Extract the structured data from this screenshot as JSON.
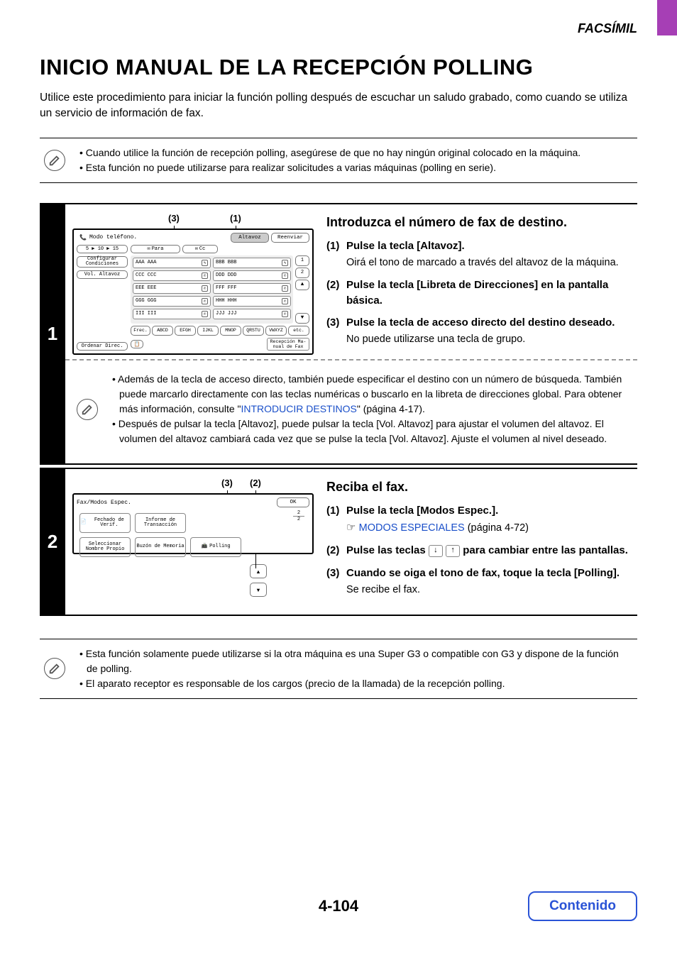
{
  "header": {
    "section_label": "FACSÍMIL"
  },
  "title": "INICIO MANUAL DE LA RECEPCIÓN POLLING",
  "intro": "Utilice este procedimiento para iniciar la función polling después de escuchar un saludo grabado, como cuando se utiliza un servicio de información de fax.",
  "note1": {
    "items": [
      "• Cuando utilice la función de recepción polling, asegúrese de que no hay ningún original colocado en la máquina.",
      "• Esta función no puede utilizarse para realizar solicitudes a varias máquinas (polling en serie)."
    ]
  },
  "step1": {
    "number": "1",
    "callouts": {
      "c1": "(1)",
      "c3": "(3)"
    },
    "heading": "Introduzca el número de fax de destino.",
    "items": [
      {
        "n": "(1)",
        "main": "Pulse la tecla [Altavoz].",
        "sub": "Oirá el tono de marcado a través del altavoz de la máquina."
      },
      {
        "n": "(2)",
        "main": "Pulse la tecla [Libreta de Direcciones] en la pantalla básica.",
        "sub": ""
      },
      {
        "n": "(3)",
        "main": "Pulse la tecla de acceso directo del destino deseado.",
        "sub": "No puede utilizarse una tecla de grupo."
      }
    ],
    "screen": {
      "title": "Modo teléfono.",
      "top_right": {
        "altavoz": "Altavoz",
        "reenviar": "Reenviar"
      },
      "para": "Para",
      "cc": "Cc",
      "scale": "5 ▶ 10 ▶ 15",
      "side": {
        "config": "Configurar Condiciones",
        "vol": "Vol. Altavoz",
        "ordenar": "Ordenar Direc."
      },
      "addresses": [
        [
          "AAA AAA",
          "BBB BBB"
        ],
        [
          "CCC CCC",
          "DDD DDD"
        ],
        [
          "EEE EEE",
          "FFF FFF"
        ],
        [
          "GGG GGG",
          "HHH HHH"
        ],
        [
          "III III",
          "JJJ JJJ"
        ]
      ],
      "page_indicator": [
        "1",
        "2"
      ],
      "frec": "Frec.",
      "tabs": [
        "ABCD",
        "EFGH",
        "IJKL",
        "MNOP",
        "QRSTU",
        "VWXYZ",
        "etc."
      ],
      "bottom_right": "Recepción Ma- nual de Fax"
    }
  },
  "midnote": {
    "items": [
      "• Además de la tecla de acceso directo, también puede especificar el destino con un número de búsqueda. También puede marcarlo directamente con las teclas numéricas o buscarlo en la libreta de direcciones global. Para obtener más información, consulte \"",
      "\" (página 4-17).",
      "• Después de pulsar la tecla [Altavoz], puede pulsar la tecla [Vol. Altavoz] para ajustar el volumen del altavoz. El volumen del altavoz cambiará cada vez que se pulse la tecla [Vol. Altavoz]. Ajuste el volumen al nivel deseado."
    ],
    "link": "INTRODUCIR DESTINOS"
  },
  "step2": {
    "number": "2",
    "callouts": {
      "c2": "(2)",
      "c3": "(3)"
    },
    "heading": "Reciba el fax.",
    "items": [
      {
        "n": "(1)",
        "main": "Pulse la tecla [Modos Espec.].",
        "link": "MODOS ESPECIALES",
        "link_suffix": " (página 4-72)"
      },
      {
        "n": "(2)",
        "main_pre": "Pulse las teclas ",
        "main_post": " para cambiar entre las pantallas."
      },
      {
        "n": "(3)",
        "main": "Cuando se oiga el tono de fax, toque la tecla [Polling].",
        "sub": "Se recibe el fax."
      }
    ],
    "screen": {
      "title": "Fax/Modos Espec.",
      "ok": "OK",
      "modes": [
        {
          "label": "Fechado de Verif."
        },
        {
          "label": "Informe de Transacción"
        },
        {
          "label": "Seleccionar Nombre Propio"
        },
        {
          "label": "Buzón de Memoria"
        },
        {
          "label": "Polling"
        }
      ],
      "page": {
        "cur": "2",
        "total": "2"
      }
    }
  },
  "footnote": {
    "items": [
      "• Esta función solamente puede utilizarse si la otra máquina es una Super G3 o compatible con G3 y dispone de la función de polling.",
      "• El aparato receptor es responsable de los cargos (precio de la llamada) de la recepción polling."
    ]
  },
  "footer": {
    "page": "4-104",
    "contents": "Contenido"
  }
}
